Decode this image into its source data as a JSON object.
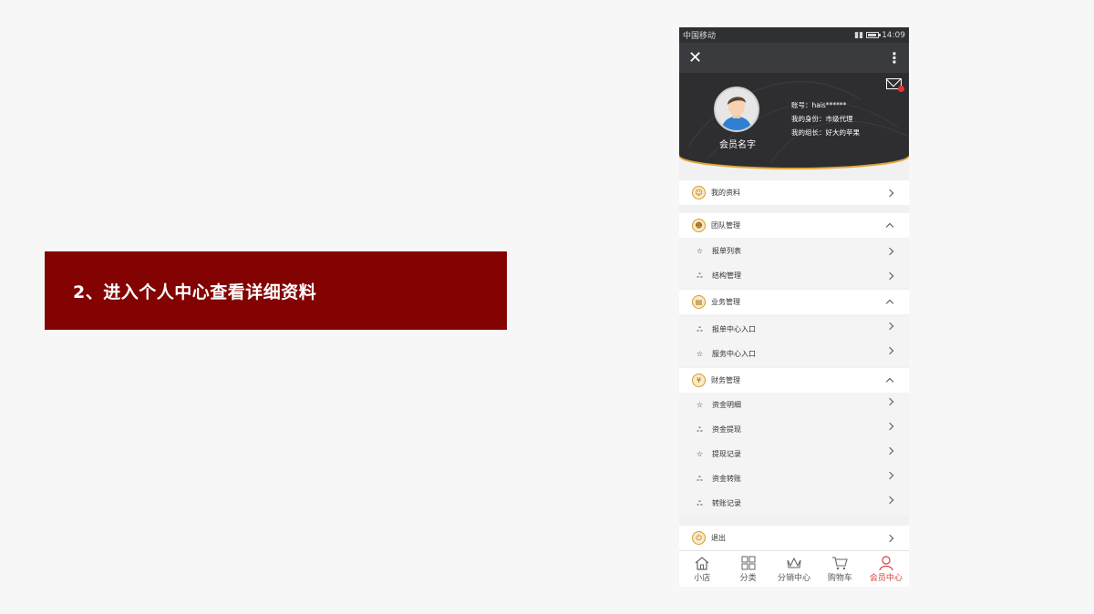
{
  "slide": {
    "title": "2、进入个人中心查看详细资料"
  },
  "status": {
    "carrier": "中国移动",
    "time": "14:09"
  },
  "profile": {
    "member_name": "会员名字",
    "account": "账号：hais******",
    "identity": "我的身份：市级代理",
    "leader": "我的组长：好大的苹果"
  },
  "menu": {
    "my_info": "我的资料",
    "team": {
      "label": "团队管理",
      "items": [
        "报单列表",
        "结构管理"
      ]
    },
    "business": {
      "label": "业务管理",
      "items": [
        "报单中心入口",
        "服务中心入口"
      ]
    },
    "finance": {
      "label": "财务管理",
      "items": [
        "资金明细",
        "资金提现",
        "提现记录",
        "资金转账",
        "转账记录"
      ]
    },
    "logout": "退出"
  },
  "tabs": [
    "小店",
    "分类",
    "分销中心",
    "购物车",
    "会员中心"
  ],
  "colors": {
    "banner": "#830202",
    "accent": "#d39a2c",
    "active_tab": "#d63e3e"
  }
}
